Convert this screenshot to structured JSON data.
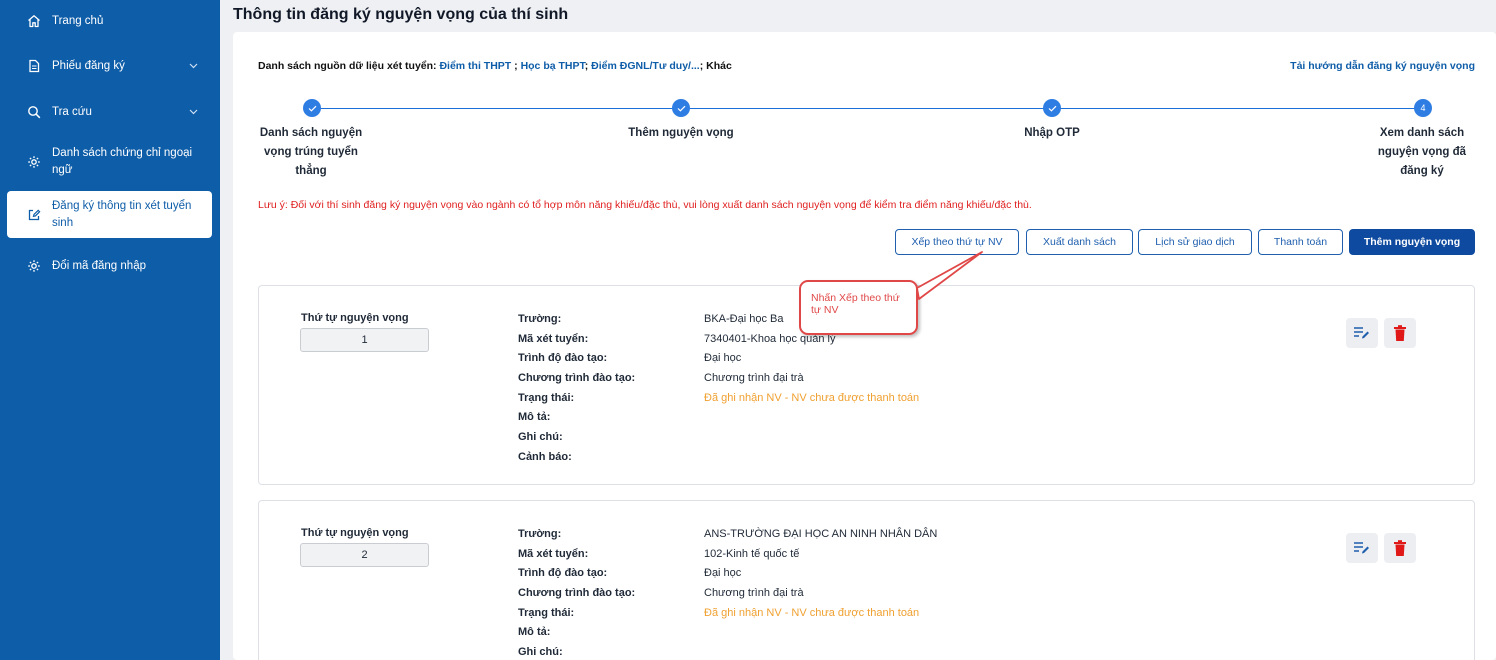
{
  "sidebar": {
    "items": [
      {
        "label": "Trang chủ",
        "icon": "home-icon"
      },
      {
        "label": "Phiếu đăng ký",
        "icon": "document-icon"
      },
      {
        "label": "Tra cứu",
        "icon": "search-icon"
      },
      {
        "label": "Danh sách chứng chỉ ngoại ngữ",
        "icon": "gear-icon"
      },
      {
        "label": "Đăng ký thông tin xét tuyển sinh",
        "icon": "edit-icon"
      },
      {
        "label": "Đổi mã đăng nhập",
        "icon": "gear-icon"
      }
    ]
  },
  "page": {
    "title": "Thông tin đăng ký nguyện vọng của thí sinh"
  },
  "sources": {
    "prefix": "Danh sách nguồn dữ liệu xét tuyển: ",
    "link1": "Điểm thi THPT",
    "sep1": " ; ",
    "link2": "Học bạ THPT",
    "sep2": "; ",
    "link3": "Điểm ĐGNL/Tư duy/...",
    "suffix": "; Khác"
  },
  "guide_link": "Tải hướng dẫn đăng ký nguyện vọng",
  "stepper": {
    "steps": [
      {
        "label": "Danh sách nguyện vọng trúng tuyển thẳng",
        "state": "done"
      },
      {
        "label": "Thêm nguyện vọng",
        "state": "done"
      },
      {
        "label": "Nhập OTP",
        "state": "done"
      },
      {
        "label": "Xem danh sách nguyện vọng đã đăng ký",
        "state": "current",
        "number": "4"
      }
    ]
  },
  "note": "Lưu ý: Đối với thí sinh đăng ký nguyện vọng vào ngành có tổ hợp môn năng khiếu/đặc thù, vui lòng xuất danh sách nguyện vọng để kiểm tra điểm năng khiếu/đặc thù.",
  "actions": {
    "sort": "Xếp theo thứ tự NV",
    "export": "Xuất danh sách",
    "history": "Lịch sử giao dịch",
    "pay": "Thanh toán",
    "add": "Thêm nguyện vọng"
  },
  "callout": "Nhấn Xếp theo thứ tự NV",
  "field_labels": {
    "order": "Thứ tự nguyện vọng",
    "school": "Trường:",
    "code": "Mã xét tuyển:",
    "level": "Trình độ đào tạo:",
    "program": "Chương trình đào tạo:",
    "status": "Trạng thái:",
    "desc": "Mô tả:",
    "notes": "Ghi chú:",
    "warning": "Cảnh báo:"
  },
  "cards": [
    {
      "order": "1",
      "school": "BKA-Đại học Ba",
      "code": "7340401-Khoa học quản lý",
      "level": "Đại học",
      "program": "Chương trình đại trà",
      "status": "Đã ghi nhận NV - NV chưa được thanh toán",
      "desc": "",
      "notes": "",
      "warning": ""
    },
    {
      "order": "2",
      "school": "ANS-TRƯỜNG ĐẠI HỌC AN NINH NHÂN DÂN",
      "code": "102-Kinh tế quốc tế",
      "level": "Đại học",
      "program": "Chương trình đại trà",
      "status": "Đã ghi nhận NV - NV chưa được thanh toán",
      "desc": "",
      "notes": ""
    }
  ],
  "colors": {
    "sidebar": "#0e5da8",
    "primary": "#0e4aa0",
    "link": "#0e5da8",
    "note": "#e02020",
    "status": "#f0a030",
    "callout": "#e04848",
    "delete": "#e01818"
  }
}
